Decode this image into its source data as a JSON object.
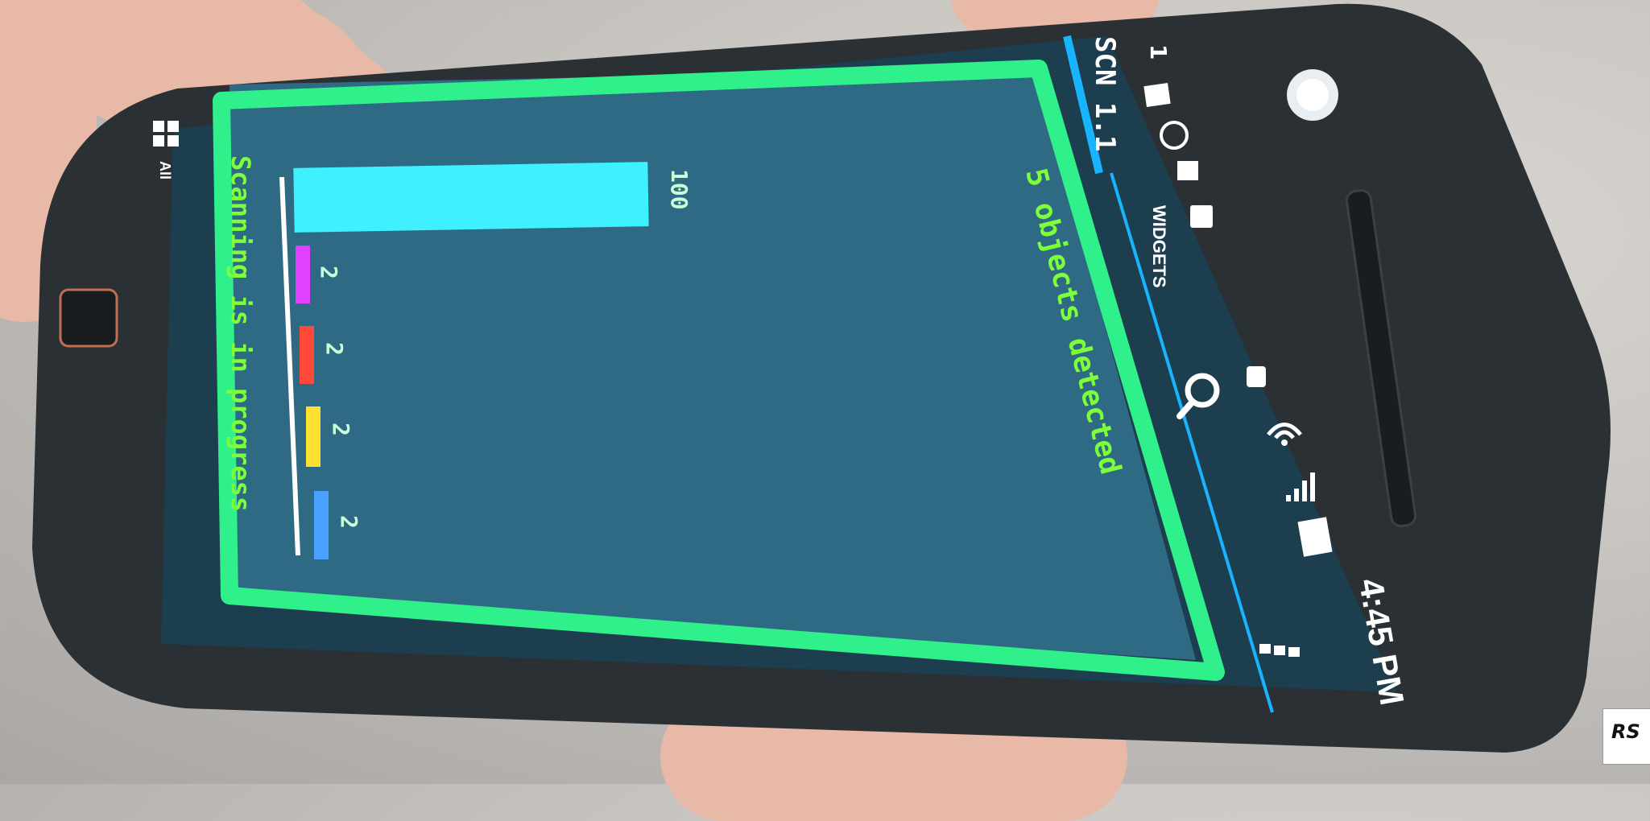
{
  "app": {
    "title": "SCN 1.1",
    "widgets_label": "WIDGETS",
    "all_label": "All"
  },
  "status_bar": {
    "time": "4:45 PM",
    "notification_count": "1"
  },
  "overlay": {
    "detected_text": "5 objects detected",
    "scanning_text": "Scanning is in progress"
  },
  "bars": [
    {
      "value": "100",
      "color": "#3ff0ff"
    },
    {
      "value": "2",
      "color": "#e040ff"
    },
    {
      "value": "2",
      "color": "#ff4a3a"
    },
    {
      "value": "2",
      "color": "#ffe030"
    },
    {
      "value": "2",
      "color": "#4aa0ff"
    }
  ],
  "colors": {
    "frame": "#2ff08a",
    "screen": "#2f6a84",
    "accent": "#18b4ff",
    "phone": "#2b3034"
  },
  "watermark": "RS"
}
